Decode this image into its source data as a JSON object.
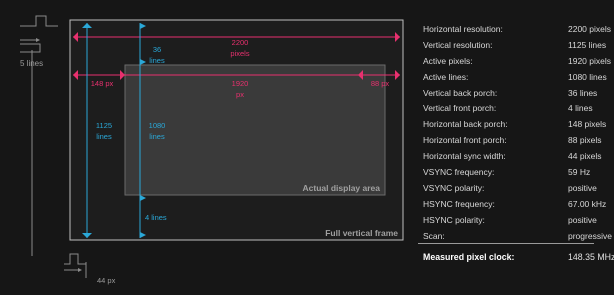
{
  "colors": {
    "background": "#161616",
    "horizontal": "#e8306e",
    "vertical": "#2aa8d8",
    "frame": "#bfbfbf",
    "display_fill": "#3a3a3a",
    "label": "#9a9a9a"
  },
  "diagram": {
    "sync_width_label": "5 lines",
    "bottom_sync_label": "44 px",
    "total_width_value": "2200",
    "total_width_unit": "pixels",
    "top_porch_value": "36",
    "top_porch_unit": "lines",
    "active_width_value": "1920",
    "active_width_unit": "px",
    "back_porch_label": "148 px",
    "front_porch_label": "88 px",
    "total_height_value": "1125",
    "total_height_unit": "lines",
    "active_height_value": "1080",
    "active_height_unit": "lines",
    "bottom_porch_label": "4 lines",
    "display_area_label": "Actual display area",
    "full_frame_label": "Full vertical frame"
  },
  "specs": [
    {
      "label": "Horizontal resolution:",
      "value": "2200 pixels"
    },
    {
      "label": "Vertical resolution:",
      "value": "1125 lines"
    },
    {
      "label": "Active pixels:",
      "value": "1920 pixels"
    },
    {
      "label": "Active lines:",
      "value": "1080 lines"
    },
    {
      "label": "Vertical back porch:",
      "value": "36 lines"
    },
    {
      "label": "Vertical front porch:",
      "value": "4 lines"
    },
    {
      "label": "Horizontal back porch:",
      "value": "148 pixels"
    },
    {
      "label": "Horizontal front porch:",
      "value": "88 pixels"
    },
    {
      "label": "Horizontal sync width:",
      "value": "44 pixels"
    },
    {
      "label": "VSYNC frequency:",
      "value": "59 Hz"
    },
    {
      "label": "VSYNC polarity:",
      "value": "positive"
    },
    {
      "label": "HSYNC frequency:",
      "value": "67.00 kHz"
    },
    {
      "label": "HSYNC polarity:",
      "value": "positive"
    },
    {
      "label": "Scan:",
      "value": "progressive"
    }
  ],
  "measured": {
    "label": "Measured pixel clock:",
    "value": "148.35 MHz"
  }
}
